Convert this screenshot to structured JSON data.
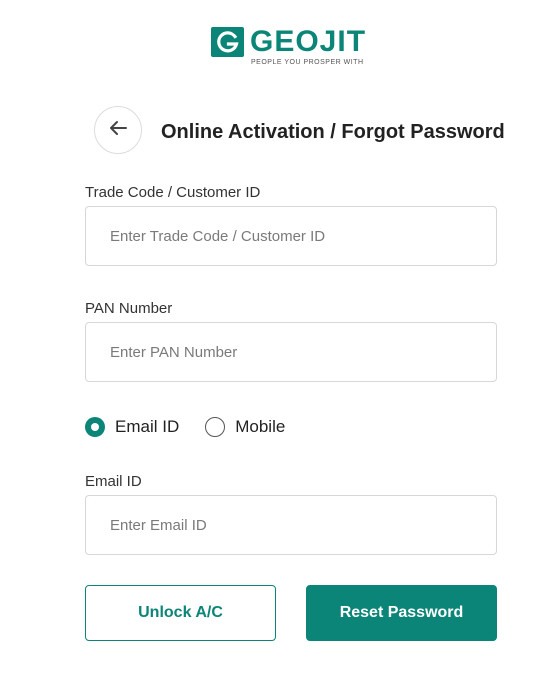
{
  "brand": {
    "name": "GEOJIT",
    "tagline": "PEOPLE YOU PROSPER WITH",
    "mark_letter": "G",
    "color": "#0b8577"
  },
  "header": {
    "back_icon": "arrow-left-icon",
    "title": "Online Activation / Forgot Password"
  },
  "form": {
    "trade_code": {
      "label": "Trade Code / Customer ID",
      "placeholder": "Enter Trade Code / Customer ID",
      "value": ""
    },
    "pan": {
      "label": "PAN Number",
      "placeholder": "Enter PAN Number",
      "value": ""
    },
    "contact_mode": {
      "options": [
        {
          "label": "Email ID",
          "selected": true
        },
        {
          "label": "Mobile",
          "selected": false
        }
      ]
    },
    "email": {
      "label": "Email ID",
      "placeholder": "Enter Email ID",
      "value": ""
    }
  },
  "actions": {
    "unlock_label": "Unlock A/C",
    "reset_label": "Reset Password"
  }
}
